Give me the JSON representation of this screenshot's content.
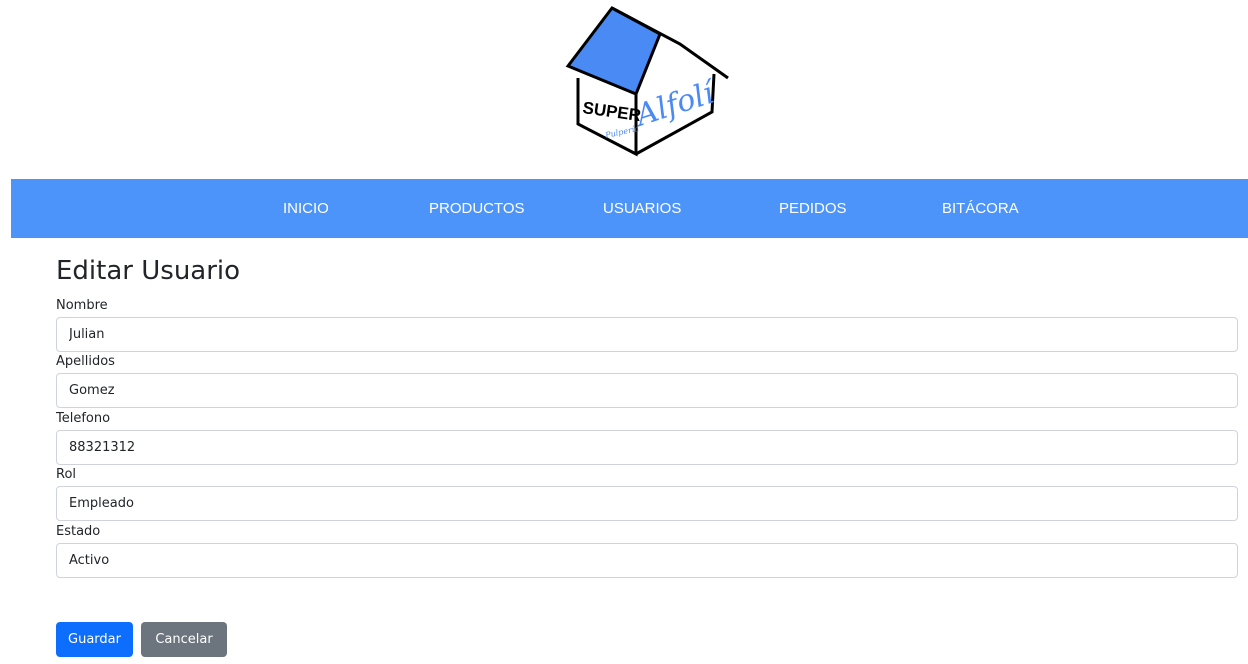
{
  "logo": {
    "word1": "SUPER",
    "word2": "Alfolí",
    "word3": "Pulpería"
  },
  "nav": {
    "items": [
      {
        "label": "INICIO"
      },
      {
        "label": "PRODUCTOS"
      },
      {
        "label": "USUARIOS"
      },
      {
        "label": "PEDIDOS"
      },
      {
        "label": "BITÁCORA"
      }
    ]
  },
  "colors": {
    "navbar": "#4d94fa",
    "primary": "#0d6efd",
    "secondary": "#6c757d",
    "roof": "#4a8af4"
  },
  "form": {
    "title": "Editar Usuario",
    "fields": [
      {
        "label": "Nombre",
        "value": "Julian"
      },
      {
        "label": "Apellidos",
        "value": "Gomez"
      },
      {
        "label": "Telefono",
        "value": "88321312"
      },
      {
        "label": "Rol",
        "value": "Empleado"
      },
      {
        "label": "Estado",
        "value": "Activo"
      }
    ],
    "save_label": "Guardar",
    "cancel_label": "Cancelar"
  }
}
